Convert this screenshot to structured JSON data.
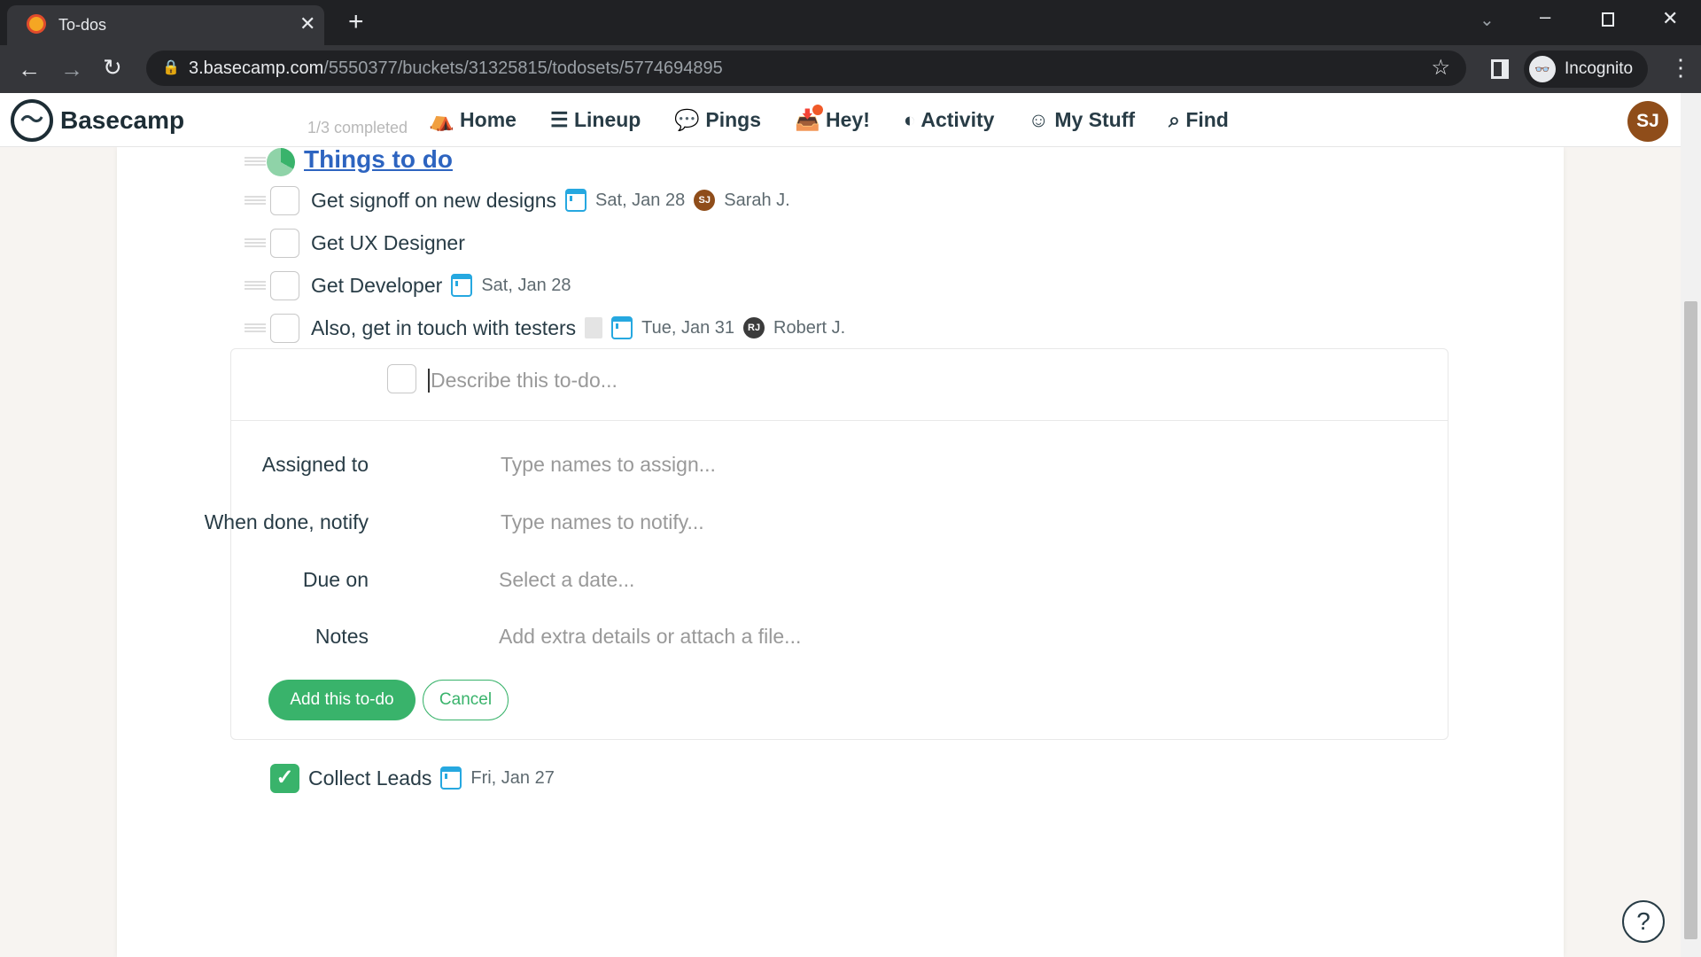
{
  "browser": {
    "tab_title": "To-dos",
    "url_host": "3.basecamp.com",
    "url_path": "/5550377/buckets/31325815/todosets/5774694895",
    "profile": "Incognito"
  },
  "nav": {
    "logo": "Basecamp",
    "items": [
      {
        "label": "Home",
        "icon": "home-icon"
      },
      {
        "label": "Lineup",
        "icon": "lineup-icon"
      },
      {
        "label": "Pings",
        "icon": "pings-icon"
      },
      {
        "label": "Hey!",
        "icon": "hey-icon"
      },
      {
        "label": "Activity",
        "icon": "activity-icon"
      },
      {
        "label": "My Stuff",
        "icon": "smiley-icon"
      },
      {
        "label": "Find",
        "icon": "search-icon"
      }
    ],
    "avatar": "SJ"
  },
  "list": {
    "progress": "1/3 completed",
    "title": "Things to do",
    "todos": [
      {
        "text": "Get signoff on new designs",
        "date": "Sat, Jan 28",
        "assignee_initials": "SJ",
        "assignee": "Sarah J."
      },
      {
        "text": "Get UX Designer"
      },
      {
        "text": "Get Developer",
        "date": "Sat, Jan 28"
      },
      {
        "text": "Also, get in touch with testers",
        "date": "Tue, Jan 31",
        "assignee_initials": "RJ",
        "assignee": "Robert J.",
        "has_notes": true
      }
    ],
    "completed": [
      {
        "text": "Collect Leads",
        "date": "Fri, Jan 27",
        "checked": true
      }
    ]
  },
  "form": {
    "placeholder": "Describe this to-do...",
    "assigned_label": "Assigned to",
    "assigned_placeholder": "Type names to assign...",
    "notify_label": "When done, notify",
    "notify_placeholder": "Type names to notify...",
    "due_label": "Due on",
    "due_placeholder": "Select a date...",
    "notes_label": "Notes",
    "notes_placeholder": "Add extra details or attach a file...",
    "submit": "Add this to-do",
    "cancel": "Cancel"
  },
  "help": "?",
  "colors": {
    "accent_green": "#39b36b",
    "link_blue": "#2d64c0",
    "calendar_blue": "#26a8e0",
    "avatar_sj": "#8f4d1a",
    "avatar_rj": "#3b3b3b"
  }
}
